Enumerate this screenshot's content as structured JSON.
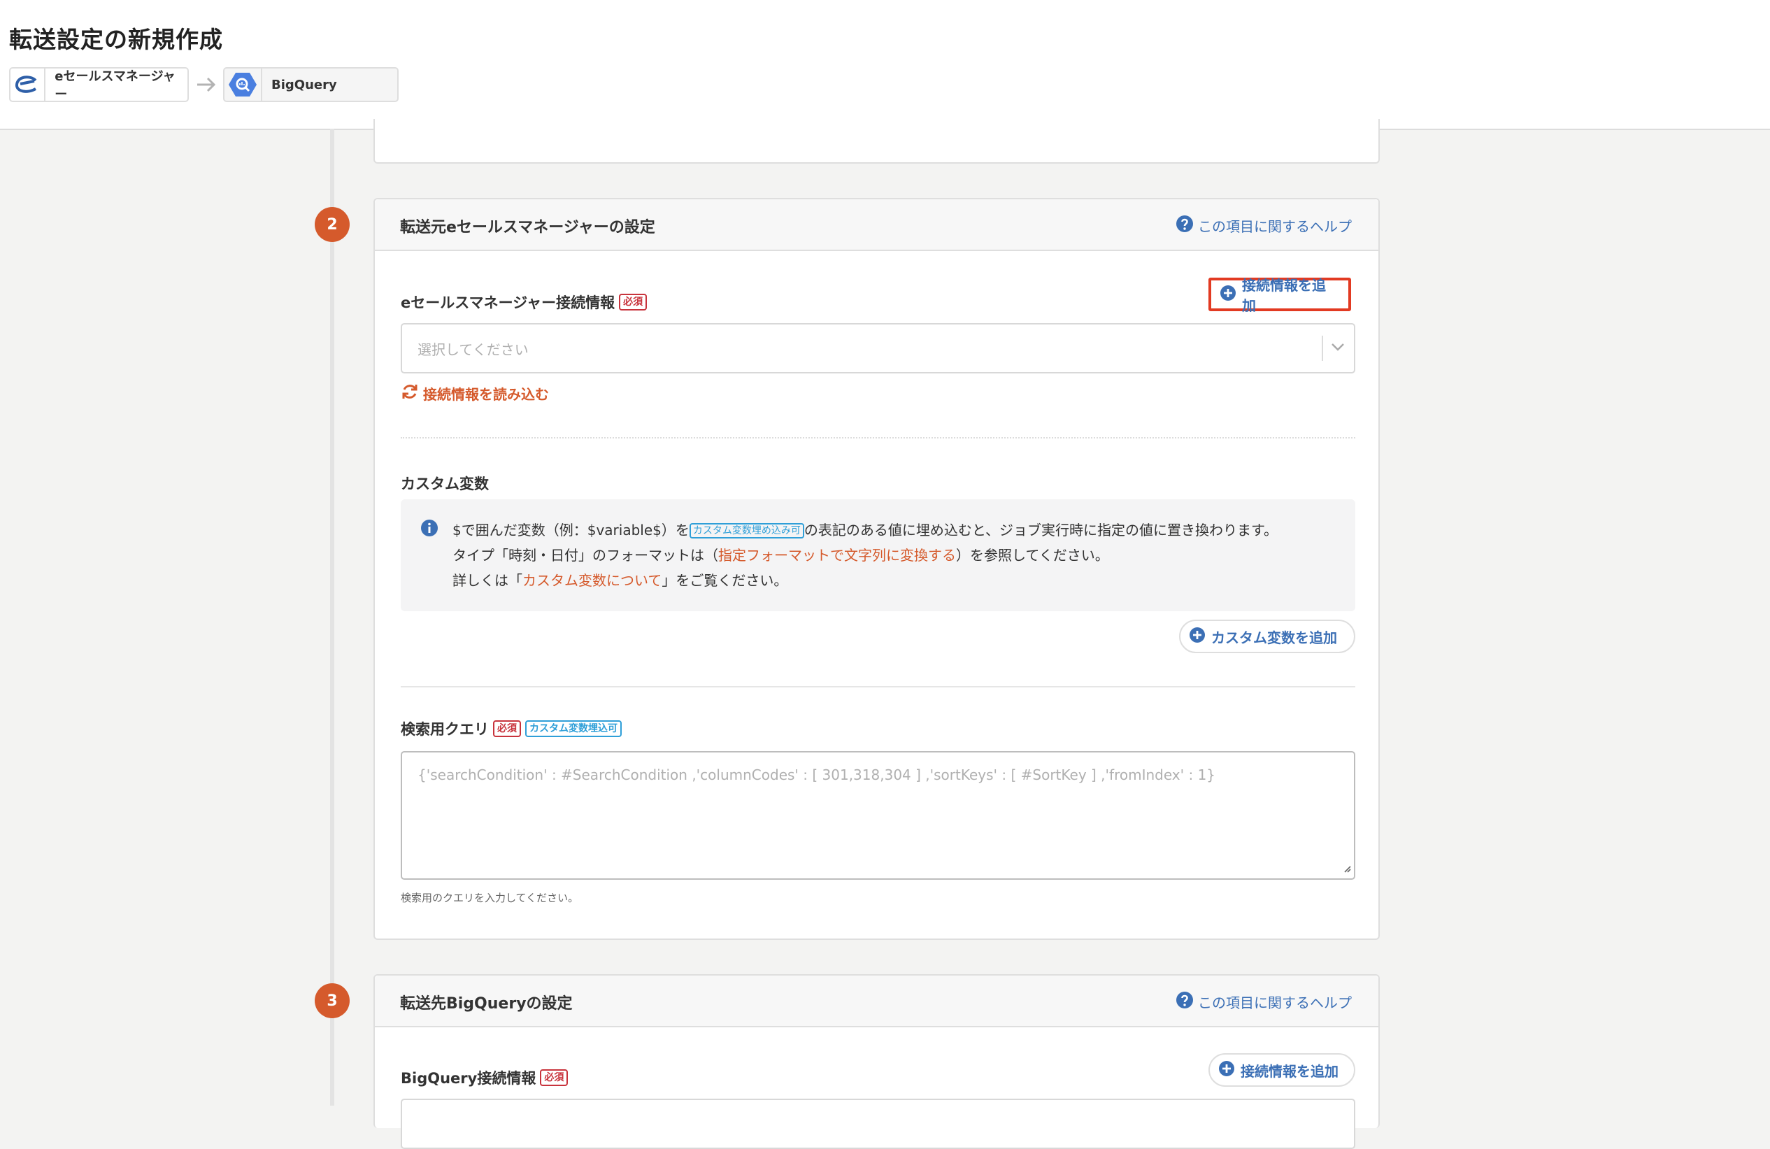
{
  "header": {
    "title": "転送設定の新規作成",
    "source_connector": {
      "label": "eセールスマネージャー",
      "icon": "esales-logo-icon"
    },
    "arrow_icon": "arrow-right-icon",
    "destination_connector": {
      "label": "BigQuery",
      "icon": "bigquery-logo-icon"
    }
  },
  "steps": {
    "source": {
      "number": "2",
      "title": "転送元eセールスマネージャーの設定",
      "help_link": "この項目に関するヘルプ",
      "connection": {
        "label": "eセールスマネージャー接続情報",
        "required_badge": "必須",
        "add_button": "接続情報を追加",
        "select_placeholder": "選択してください",
        "reload_link": "接続情報を読み込む"
      },
      "custom_vars": {
        "label": "カスタム変数",
        "info_line1_a": "$で囲んだ変数（例：$variable$）を",
        "info_line1_badge": "カスタム変数埋め込み可",
        "info_line1_b": "の表記のある値に埋め込むと、ジョブ実行時に指定の値に置き換わります。",
        "info_line2_a": "タイプ「時刻・日付」のフォーマットは（",
        "info_line2_link": "指定フォーマットで文字列に変換する",
        "info_line2_b": "）を参照してください。",
        "info_line3_a": "詳しくは「",
        "info_line3_link": "カスタム変数について",
        "info_line3_b": "」をご覧ください。",
        "add_button": "カスタム変数を追加"
      },
      "query": {
        "label": "検索用クエリ",
        "required_badge": "必須",
        "var_badge": "カスタム変数埋込可",
        "placeholder": "{'searchCondition' : #SearchCondition ,'columnCodes' : [ 301,318,304 ] ,'sortKeys' : [ #SortKey ] ,'fromIndex' : 1}",
        "hint": "検索用のクエリを入力してください。"
      }
    },
    "destination": {
      "number": "3",
      "title": "転送先BigQueryの設定",
      "help_link": "この項目に関するヘルプ",
      "connection": {
        "label": "BigQuery接続情報",
        "required_badge": "必須",
        "add_button": "接続情報を追加"
      }
    }
  },
  "colors": {
    "accent_orange": "#d55a2c",
    "link_blue": "#3b6fb5",
    "required_red": "#c8333c",
    "variable_cyan": "#2f9fd8",
    "highlight_red": "#e23a22"
  }
}
